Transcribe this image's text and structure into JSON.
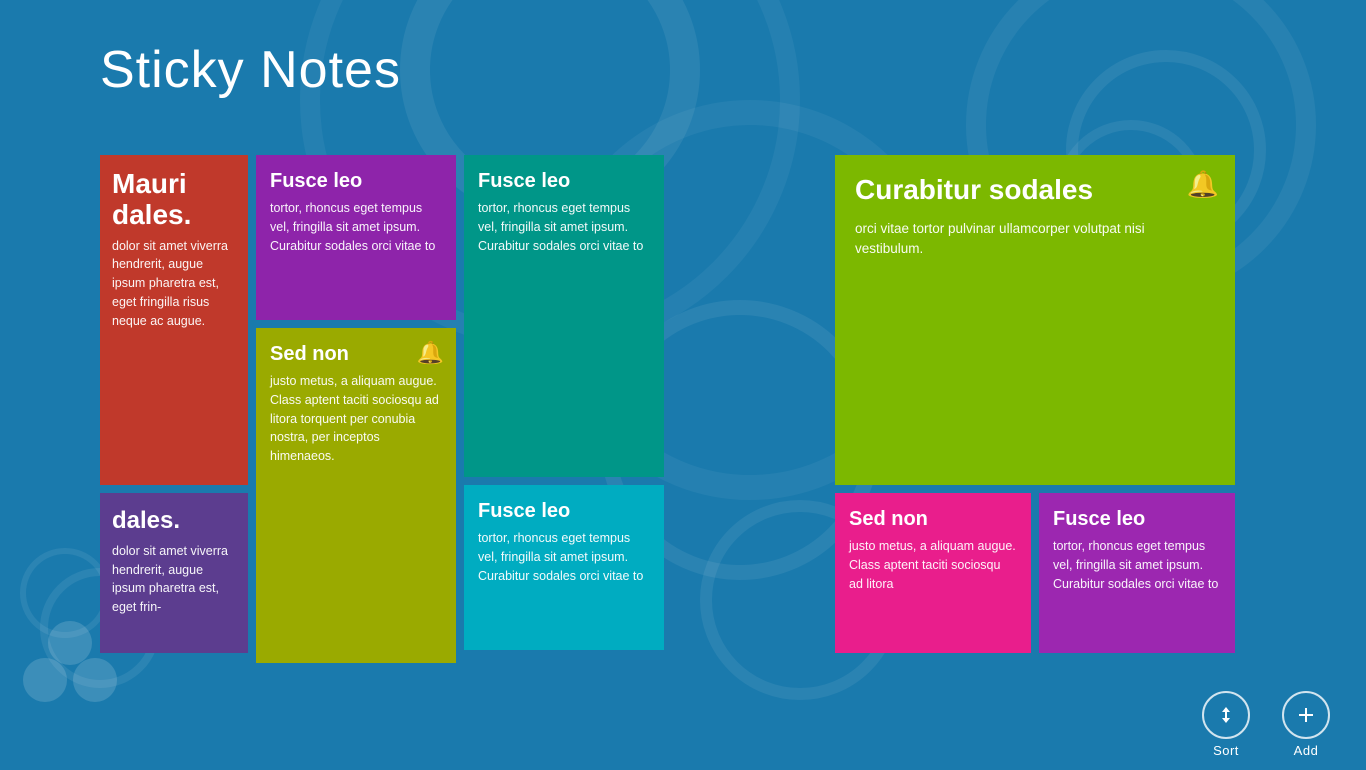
{
  "app": {
    "title": "Sticky Notes",
    "background_color": "#1a7aad"
  },
  "notes": [
    {
      "id": "note-1",
      "color": "red",
      "title": "Mauri dales.",
      "body": "dolor sit amet viverra hendrerit, augue ipsum pharetra est, eget fringilla risus neque ac augue.",
      "bell": false,
      "col": 1,
      "row": 1,
      "rowspan": 2
    },
    {
      "id": "note-2",
      "color": "purple",
      "title": "Fusce leo",
      "body": "tortor, rhoncus eget tempus vel, fringilla sit amet ipsum. Curabitur sodales orci vitae to",
      "bell": false,
      "col": 2,
      "row": 1
    },
    {
      "id": "note-3",
      "color": "olive",
      "title": "Sed non",
      "body": "justo metus, a aliquam augue. Class aptent taciti sociosqu ad litora torquent per conubia nostra, per inceptos himenaeos.",
      "bell": true,
      "col": 2,
      "row": 2,
      "rowspan": 2
    },
    {
      "id": "note-4",
      "color": "teal",
      "title": "Fusce leo",
      "body": "tortor, rhoncus eget tempus vel, fringilla sit amet ipsum. Curabitur sodales orci vitae to",
      "bell": false,
      "col": 3,
      "row": 1,
      "rowspan": 2
    },
    {
      "id": "note-5",
      "color": "teal-light",
      "title": "Fusce leo",
      "body": "tortor, rhoncus eget tempus vel, fringilla sit amet ipsum. Curabitur sodales orci vitae to",
      "bell": false,
      "col": 3,
      "row": 3
    },
    {
      "id": "note-6",
      "color": "green",
      "title": "Curabitur sodales",
      "body": "orci vitae tortor pulvinar ullamcorper volutpat nisi vestibulum.",
      "bell": true,
      "col": 5,
      "row": 1,
      "rowspan": 2,
      "colspan": 2
    },
    {
      "id": "note-7",
      "color": "pink",
      "title": "Sed non",
      "body": "justo metus, a aliquam augue. Class aptent taciti sociosqu ad litora",
      "bell": false,
      "col": 5,
      "row": 3
    },
    {
      "id": "note-8",
      "color": "magenta",
      "title": "Fusce leo",
      "body": "tortor, rhoncus eget tempus vel, fringilla sit amet ipsum. Curabitur sodales orci vitae to",
      "bell": false,
      "col": 6,
      "row": 3
    },
    {
      "id": "note-9",
      "color": "blue-purple",
      "title": "dales.",
      "body": "dolor sit amet viverra hendrerit, augue ipsum pharetra est, eget frin-",
      "bell": false,
      "col": 1,
      "row": 3
    }
  ],
  "bottom_bar": {
    "sort_label": "Sort",
    "add_label": "Add"
  },
  "colors": {
    "red": "#c0392b",
    "purple": "#8e24aa",
    "olive": "#8f9800",
    "teal": "#009688",
    "teal_light": "#00bcd4",
    "green": "#7cb800",
    "pink": "#e91e8c",
    "magenta": "#9c27b0",
    "blue_purple": "#5c3d8f"
  }
}
